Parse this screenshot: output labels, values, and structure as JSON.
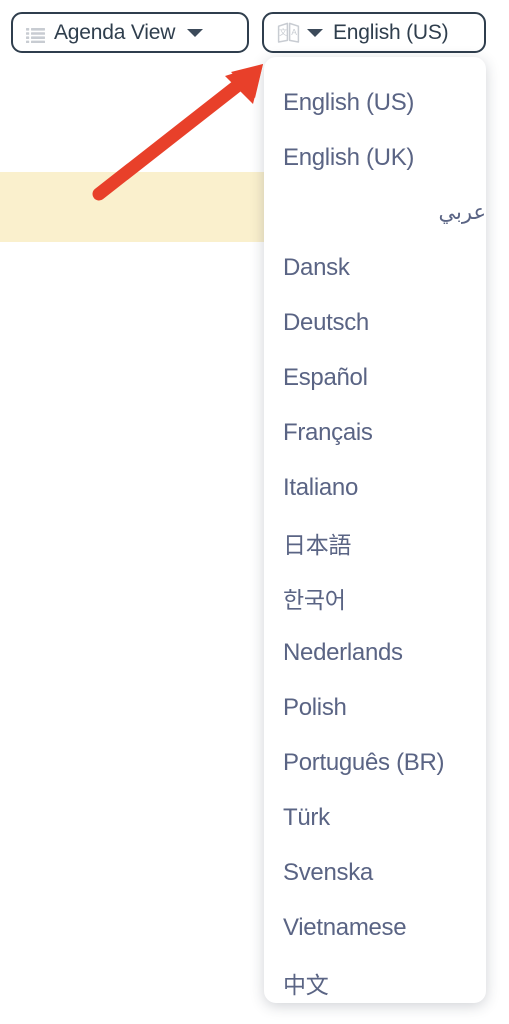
{
  "toolbar": {
    "agenda_view": {
      "label": "Agenda View",
      "icon": "list-icon",
      "caret": "chevron-down-icon"
    },
    "language_selector": {
      "label": "English (US)",
      "icon": "translate-icon",
      "caret": "chevron-down-icon"
    }
  },
  "language_dropdown": {
    "open": true,
    "selected": "English (US)",
    "items": [
      {
        "label": "English (US)",
        "dir": "ltr",
        "script": "latin"
      },
      {
        "label": "English (UK)",
        "dir": "ltr",
        "script": "latin"
      },
      {
        "label": "عربي",
        "dir": "rtl",
        "script": "arabic"
      },
      {
        "label": "Dansk",
        "dir": "ltr",
        "script": "latin"
      },
      {
        "label": "Deutsch",
        "dir": "ltr",
        "script": "latin"
      },
      {
        "label": "Español",
        "dir": "ltr",
        "script": "latin"
      },
      {
        "label": "Français",
        "dir": "ltr",
        "script": "latin"
      },
      {
        "label": "Italiano",
        "dir": "ltr",
        "script": "latin"
      },
      {
        "label": "日本語",
        "dir": "ltr",
        "script": "cjk"
      },
      {
        "label": "한국어",
        "dir": "ltr",
        "script": "cjk"
      },
      {
        "label": "Nederlands",
        "dir": "ltr",
        "script": "latin"
      },
      {
        "label": "Polish",
        "dir": "ltr",
        "script": "latin"
      },
      {
        "label": "Português (BR)",
        "dir": "ltr",
        "script": "latin"
      },
      {
        "label": "Türk",
        "dir": "ltr",
        "script": "latin"
      },
      {
        "label": "Svenska",
        "dir": "ltr",
        "script": "latin"
      },
      {
        "label": "Vietnamese",
        "dir": "ltr",
        "script": "latin"
      },
      {
        "label": "中文",
        "dir": "ltr",
        "script": "cjk"
      }
    ]
  },
  "annotation": {
    "arrow": "red-arrow-pointing-to-language-button",
    "color": "#e8402a"
  },
  "colors": {
    "button_border": "#2f3e4d",
    "button_text": "#2f3e4d",
    "dropdown_text": "#5a6484",
    "highlight_band": "#faf0cd",
    "icon_gray": "#c8ccd2",
    "page_background": "#ffffff"
  }
}
